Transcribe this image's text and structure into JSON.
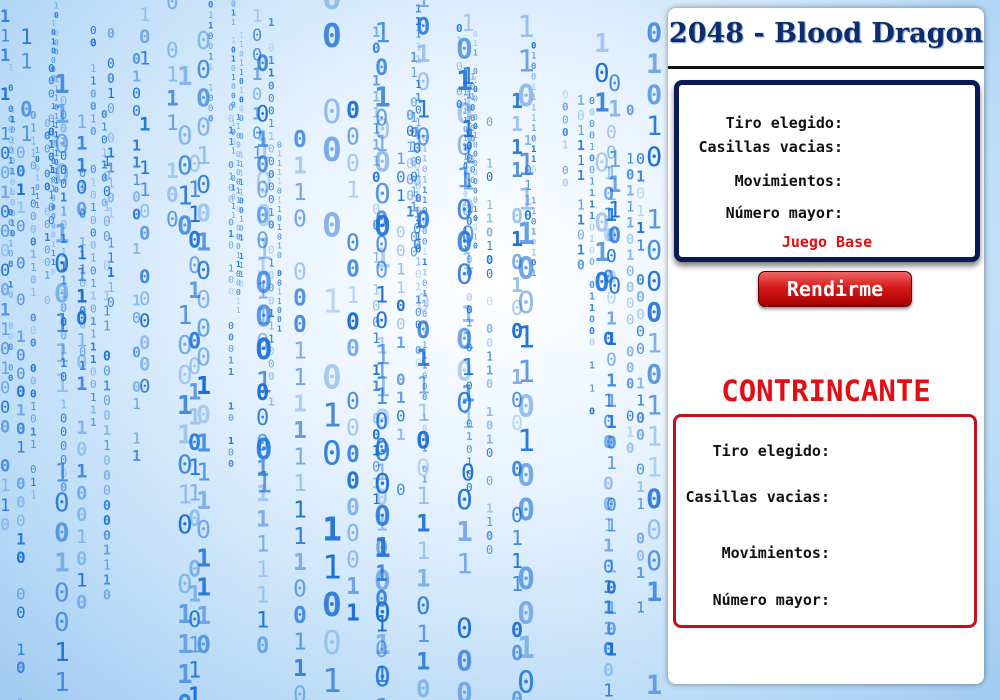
{
  "app": {
    "title": "2048 - Blood Dragon"
  },
  "player_stats": {
    "tiro_label": "Tiro elegido:",
    "casillas_label": "Casillas vacias:",
    "movimientos_label": "Movimientos:",
    "numero_label": "Número mayor:",
    "mode_label": "Juego Base"
  },
  "surrender_button": {
    "label": "Rendirme"
  },
  "opponent": {
    "heading": "CONTRINCANTE",
    "tiro_label": "Tiro elegido:",
    "casillas_label": "Casillas vacias:",
    "movimientos_label": "Movimientos:",
    "numero_label": "Número mayor:"
  },
  "colors": {
    "title": "#0c2c6e",
    "player_border": "#0b1a55",
    "accent_red": "#e40d14",
    "background_digits": "#1a6fd8"
  },
  "background": {
    "pattern": "binary digit rain (0 and 1)"
  }
}
